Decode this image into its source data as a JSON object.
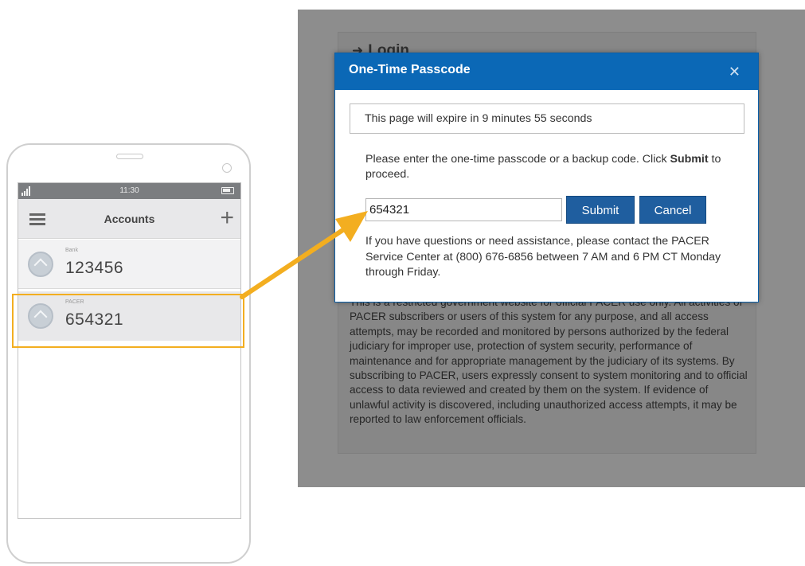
{
  "phone": {
    "status_time": "11:30",
    "app_title": "Accounts",
    "accounts": [
      {
        "issuer": "Bank",
        "code": "123456"
      },
      {
        "issuer": "PACER",
        "code": "654321"
      }
    ]
  },
  "login": {
    "heading": "Login"
  },
  "modal": {
    "title": "One-Time Passcode",
    "expiry": "This page will expire in 9 minutes 55 seconds",
    "instruction_a": "Please enter the one-time passcode or a backup code. Click ",
    "instruction_bold": "Submit",
    "instruction_b": " to proceed.",
    "passcode_value": "654321",
    "submit_label": "Submit",
    "cancel_label": "Cancel",
    "help": "If you have questions or need assistance, please contact the PACER Service Center at (800) 676-6856 between 7 AM and 6 PM CT Monday through Friday."
  },
  "warning_text": "This is a restricted government website for official PACER use only. All activities of PACER subscribers or users of this system for any purpose, and all access attempts, may be recorded and monitored by persons authorized by the federal judiciary for improper use, protection of system security, performance of maintenance and for appropriate management by the judiciary of its systems. By subscribing to PACER, users expressly consent to system monitoring and to official access to data reviewed and created by them on the system. If evidence of unlawful activity is discovered, including unauthorized access attempts, it may be reported to law enforcement officials.",
  "colors": {
    "modal_header": "#0b68b6",
    "button": "#1f5e9f",
    "highlight": "#f3ae20",
    "overlay": "#8d8d8d"
  },
  "icons": [
    "signal-icon",
    "battery-icon",
    "menu-icon",
    "add-icon",
    "account-avatar-icon",
    "login-icon",
    "close-icon",
    "arrow-icon"
  ]
}
